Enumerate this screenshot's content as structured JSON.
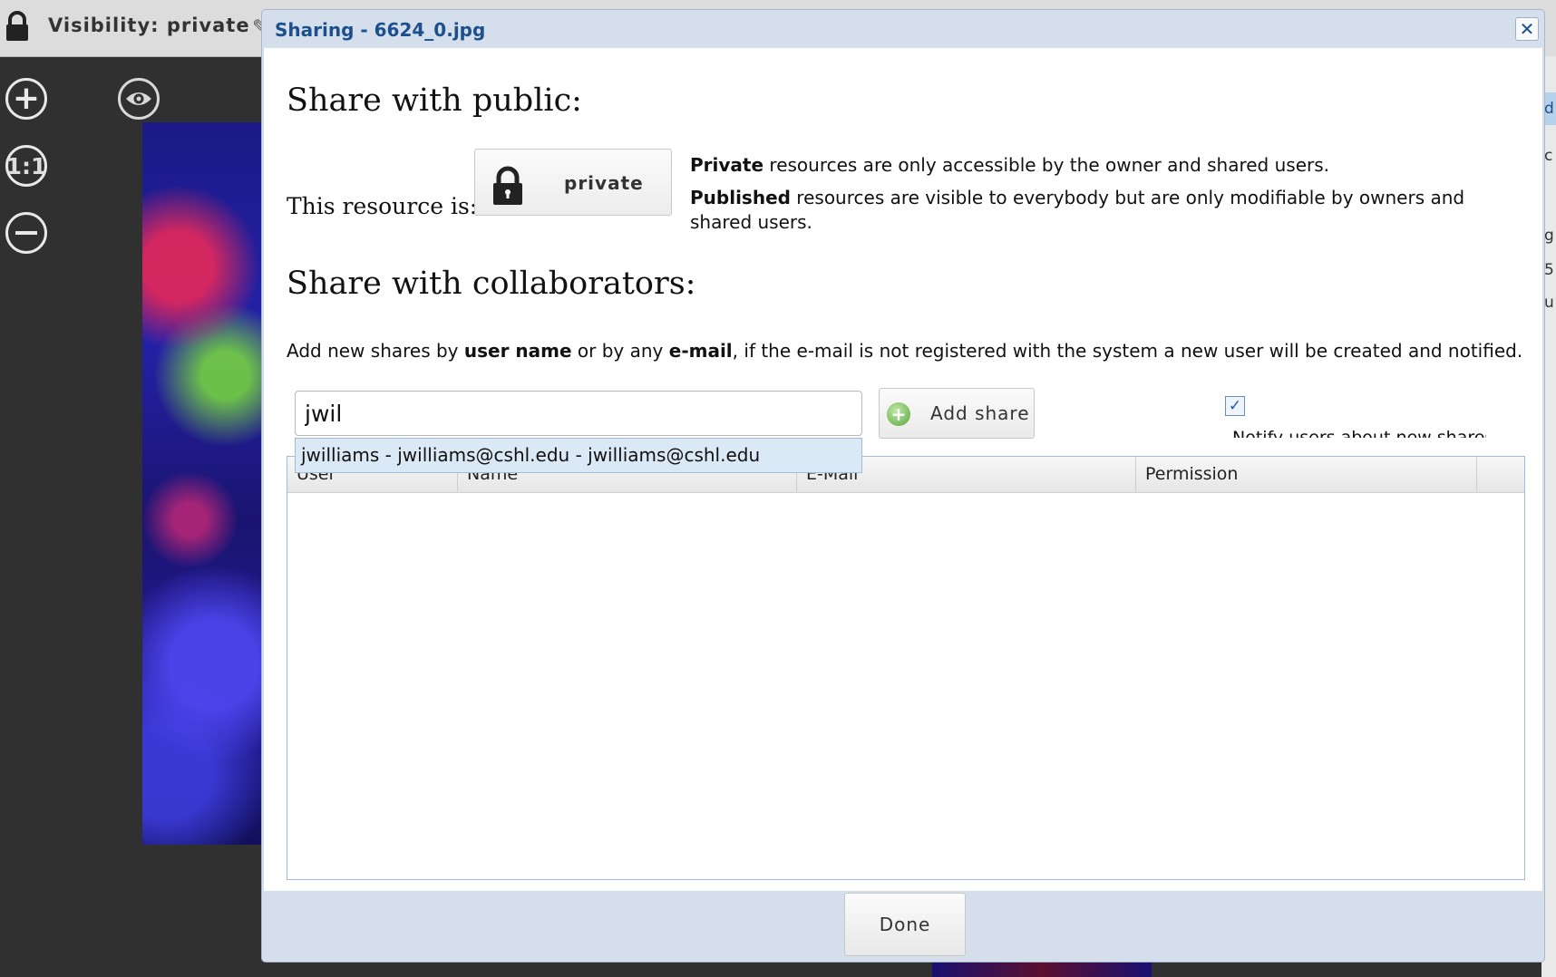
{
  "app": {
    "visibility_label": "Visibility: private",
    "tools": {
      "one_to_one": "1:1"
    }
  },
  "right_strip": {
    "chars": [
      "d",
      "c",
      "g",
      "5",
      "u"
    ]
  },
  "dialog": {
    "title": "Sharing - 6624_0.jpg",
    "close_glyph": "✕",
    "public": {
      "heading": "Share with public:",
      "resource_label": "This resource is:",
      "status_button": "private",
      "desc_private_bold": "Private",
      "desc_private_rest": " resources are only accessible by the owner and shared users.",
      "desc_published_bold": "Published",
      "desc_published_rest": " resources are visible to everybody but are only modifiable by owners and shared users."
    },
    "collaborators": {
      "heading": "Share with collaborators:",
      "desc_part1": "Add new shares by ",
      "desc_bold1": "user name",
      "desc_part2": " or by any ",
      "desc_bold2": "e-mail",
      "desc_part3": ", if the e-mail is not registered with the system a new user will be created and notified.",
      "input_value": "jwil",
      "add_button": "Add share",
      "notify_checked": true,
      "notify_label": "Notify users about new shares",
      "suggestion": "jwilliams - jwilliams@cshl.edu - jwilliams@cshl.edu"
    },
    "table": {
      "columns": [
        "User",
        "Name",
        "E-Mail",
        "Permission"
      ]
    },
    "done_button": "Done"
  }
}
